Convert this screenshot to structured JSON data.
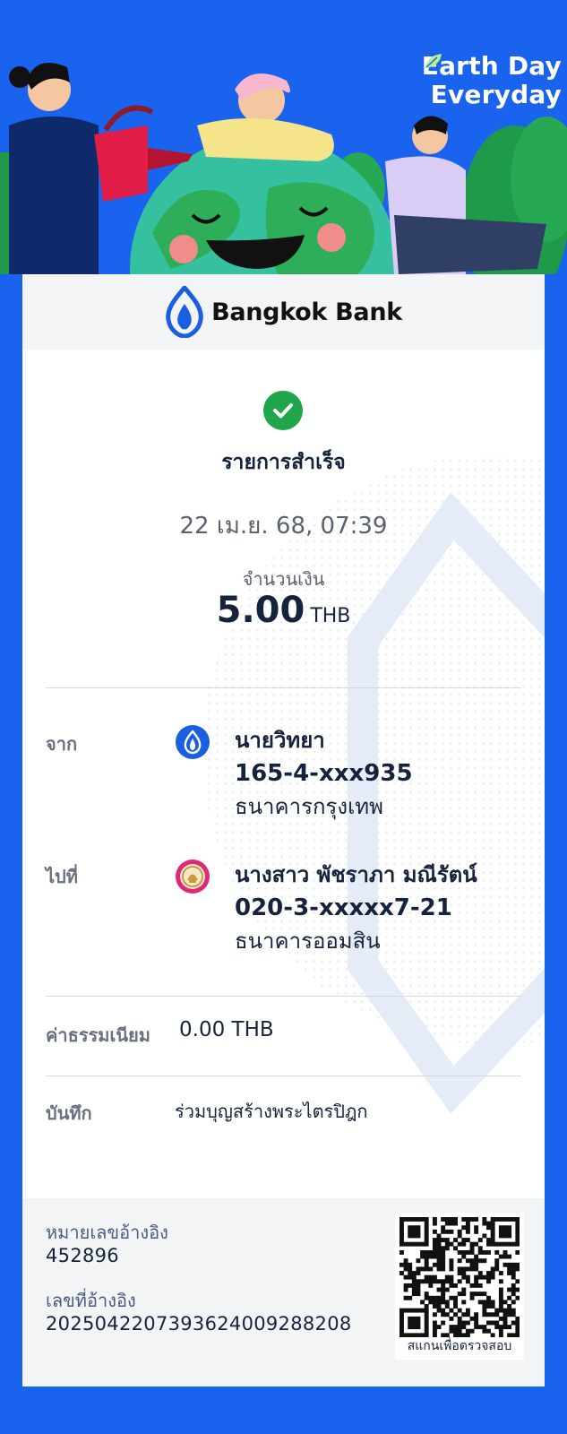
{
  "banner": {
    "title_line1": "Earth Day",
    "title_line2": "Everyday"
  },
  "header": {
    "bank_name": "Bangkok Bank"
  },
  "status": {
    "text": "รายการสำเร็จ",
    "datetime": "22 เม.ย. 68, 07:39",
    "amount_label": "จำนวนเงิน",
    "amount": "5.00",
    "currency": "THB"
  },
  "from": {
    "label": "จาก",
    "name": "นายวิทยา",
    "account": "165-4-xxx935",
    "bank": "ธนาคารกรุงเทพ"
  },
  "to": {
    "label": "ไปที่",
    "name": "นางสาว พัชราภา มณีรัตน์",
    "account": "020-3-xxxxx7-21",
    "bank": "ธนาคารออมสิน"
  },
  "fee": {
    "label": "ค่าธรรมเนียม",
    "value": "0.00 THB"
  },
  "memo": {
    "label": "บันทึก",
    "value": "ร่วมบุญสร้างพระไตรปิฎก"
  },
  "reference": {
    "ref1_label": "หมายเลขอ้างอิง",
    "ref1_value": "452896",
    "ref2_label": "เลขที่อ้างอิง",
    "ref2_value": "2025042207393624009288208",
    "qr_caption": "สแกนเพื่อตรวจสอบ"
  },
  "colors": {
    "background": "#1a63ef",
    "success": "#1fa64a",
    "bbl_blue": "#1a5fe0",
    "gsb_pink": "#e0287a"
  }
}
